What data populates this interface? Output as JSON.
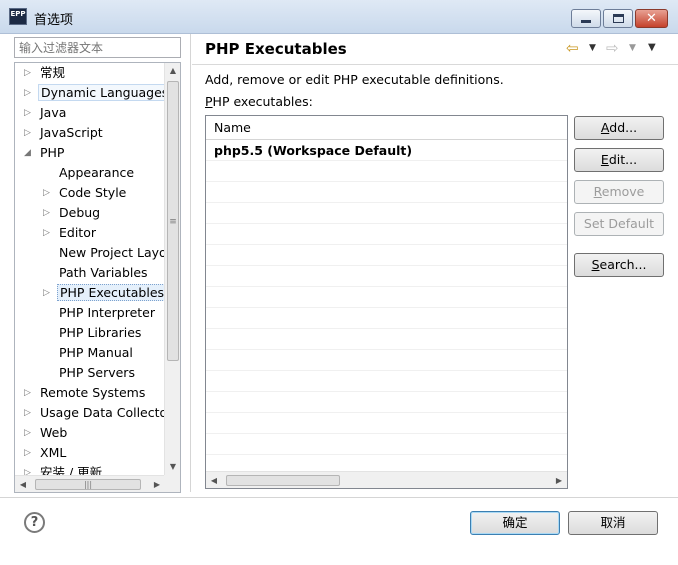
{
  "window": {
    "title": "首选项",
    "app_icon_text": "EPP"
  },
  "filter": {
    "placeholder": "输入过滤器文本"
  },
  "tree": {
    "items": [
      {
        "label": "常规",
        "level": 0,
        "expander": "closed"
      },
      {
        "label": "Dynamic Languages",
        "level": 0,
        "expander": "closed",
        "state": "hover"
      },
      {
        "label": "Java",
        "level": 0,
        "expander": "closed"
      },
      {
        "label": "JavaScript",
        "level": 0,
        "expander": "closed"
      },
      {
        "label": "PHP",
        "level": 0,
        "expander": "open"
      },
      {
        "label": "Appearance",
        "level": 1,
        "expander": "none"
      },
      {
        "label": "Code Style",
        "level": 1,
        "expander": "closed"
      },
      {
        "label": "Debug",
        "level": 1,
        "expander": "closed"
      },
      {
        "label": "Editor",
        "level": 1,
        "expander": "closed"
      },
      {
        "label": "New Project Layout",
        "level": 1,
        "expander": "none"
      },
      {
        "label": "Path Variables",
        "level": 1,
        "expander": "none"
      },
      {
        "label": "PHP Executables",
        "level": 1,
        "expander": "closed",
        "state": "selected"
      },
      {
        "label": "PHP Interpreter",
        "level": 1,
        "expander": "none"
      },
      {
        "label": "PHP Libraries",
        "level": 1,
        "expander": "none"
      },
      {
        "label": "PHP Manual",
        "level": 1,
        "expander": "none"
      },
      {
        "label": "PHP Servers",
        "level": 1,
        "expander": "none"
      },
      {
        "label": "Remote Systems",
        "level": 0,
        "expander": "closed"
      },
      {
        "label": "Usage Data Collector",
        "level": 0,
        "expander": "closed"
      },
      {
        "label": "Web",
        "level": 0,
        "expander": "closed"
      },
      {
        "label": "XML",
        "level": 0,
        "expander": "closed"
      },
      {
        "label": "安装 / 更新",
        "level": 0,
        "expander": "closed"
      }
    ]
  },
  "page": {
    "title": "PHP Executables",
    "description": "Add, remove or edit PHP executable definitions.",
    "list_label_mnemonic": "P",
    "list_label_rest": "HP executables:",
    "table": {
      "column": "Name",
      "rows": [
        "php5.5 (Workspace Default)",
        "",
        "",
        "",
        "",
        "",
        "",
        "",
        "",
        "",
        "",
        "",
        "",
        "",
        "",
        ""
      ]
    },
    "buttons": {
      "add": {
        "mnemonic": "A",
        "rest": "dd..."
      },
      "edit": {
        "mnemonic": "E",
        "rest": "dit..."
      },
      "remove": {
        "mnemonic": "R",
        "rest": "emove"
      },
      "set_default": {
        "label": "Set Default"
      },
      "search": {
        "mnemonic": "S",
        "rest": "earch..."
      }
    }
  },
  "footer": {
    "help": "?",
    "ok": "确定",
    "cancel": "取消"
  },
  "icons": {
    "back": "back-arrow-icon",
    "forward": "forward-arrow-icon",
    "view_menu": "view-menu-icon"
  },
  "colors": {
    "selection_fill": "#e5f0fb",
    "selection_border": "#7da2ce",
    "default_button_border": "#3c7fb1",
    "back_arrow": "#c8961e"
  }
}
